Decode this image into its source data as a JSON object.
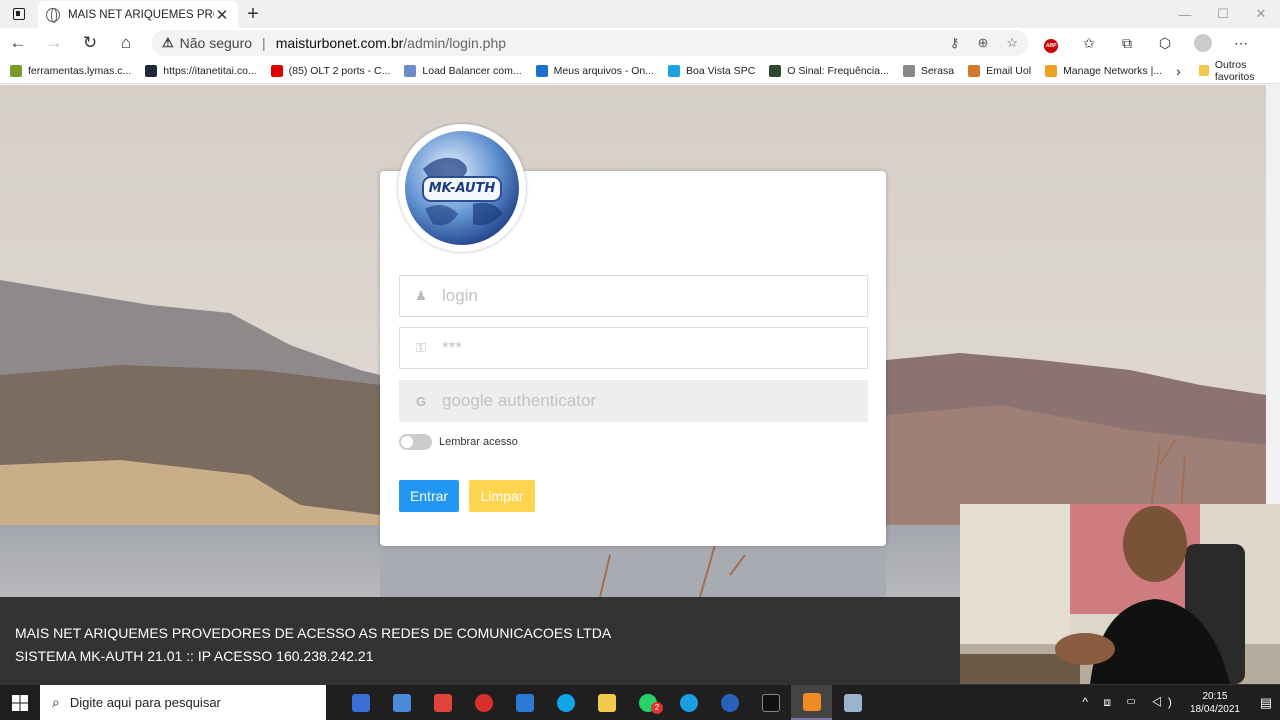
{
  "browser": {
    "tab_title": "MAIS NET ARIQUEMES PROVEDO",
    "new_tab_label": "+",
    "insecure_label": "Não seguro",
    "url_host": "maisturbonet.com.br",
    "url_path": "/admin/login.php"
  },
  "bookmarks": [
    {
      "label": "ferramentas.lymas.c...",
      "color": "#7a9a2a"
    },
    {
      "label": "https://itanetitai.co...",
      "color": "#1e2a3a"
    },
    {
      "label": "(85) OLT 2 ports - C...",
      "color": "#e00000"
    },
    {
      "label": "Load Balancer com...",
      "color": "#6b8cc9"
    },
    {
      "label": "Meus arquivos - On...",
      "color": "#1e6fd0"
    },
    {
      "label": "Boa Vista SPC",
      "color": "#1aa3e0"
    },
    {
      "label": "O Sinal: Frequência...",
      "color": "#2e4a2e"
    },
    {
      "label": "Serasa",
      "color": "#888888"
    },
    {
      "label": "Email Uol",
      "color": "#d07a2a"
    },
    {
      "label": "Manage Networks |...",
      "color": "#f0a020"
    }
  ],
  "bookmarks_folder": "Outros favoritos",
  "login": {
    "logo_text": "MK-AUTH",
    "login_placeholder": "login",
    "password_placeholder": "***",
    "google_placeholder": "google authenticator",
    "remember_label": "Lembrar acesso",
    "submit_label": "Entrar",
    "clear_label": "Limpar"
  },
  "footer": {
    "company": "MAIS NET ARIQUEMES PROVEDORES DE ACESSO AS REDES DE COMUNICACOES LTDA",
    "system": "SISTEMA MK-AUTH 21.01 :: IP ACESSO 160.238.242.21"
  },
  "taskbar": {
    "search_placeholder": "Digite aqui para pesquisar",
    "time": "20:15",
    "date": "18/04/2021",
    "whatsapp_badge": "2"
  }
}
